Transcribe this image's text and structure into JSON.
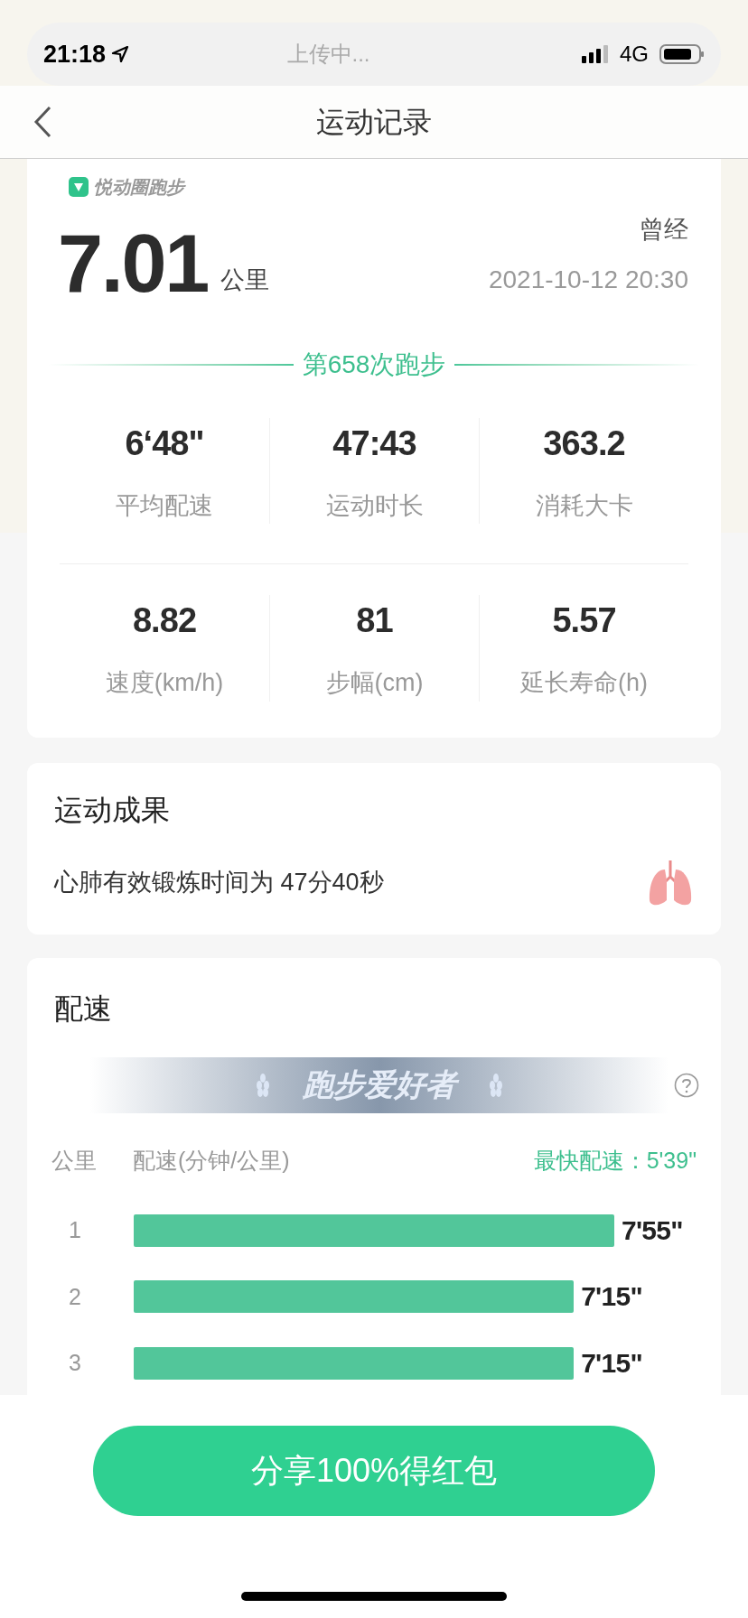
{
  "status_bar": {
    "time": "21:18",
    "center_text": "上传中...",
    "network": "4G"
  },
  "nav": {
    "title": "运动记录"
  },
  "summary": {
    "brand": "悦动圈跑步",
    "distance": "7.01",
    "unit": "公里",
    "user": "曾经",
    "datetime": "2021-10-12 20:30",
    "run_count": "第658次跑步",
    "stats": [
      {
        "value": "6‘48\"",
        "label": "平均配速"
      },
      {
        "value": "47:43",
        "label": "运动时长"
      },
      {
        "value": "363.2",
        "label": "消耗大卡"
      },
      {
        "value": "8.82",
        "label": "速度(km/h)"
      },
      {
        "value": "81",
        "label": "步幅(cm)"
      },
      {
        "value": "5.57",
        "label": "延长寿命(h)"
      }
    ]
  },
  "achievement": {
    "title": "运动成果",
    "text": "心肺有效锻炼时间为 47分40秒"
  },
  "pace": {
    "title": "配速",
    "badge": "跑步爱好者",
    "columns": [
      "公里",
      "配速(分钟/公里)"
    ],
    "fastest": "最快配速：5'39\"",
    "splits": [
      {
        "km": "1",
        "pace": "7'55\""
      },
      {
        "km": "2",
        "pace": "7'15\""
      },
      {
        "km": "3",
        "pace": "7'15\""
      }
    ]
  },
  "share_button": "分享100%得红包"
}
